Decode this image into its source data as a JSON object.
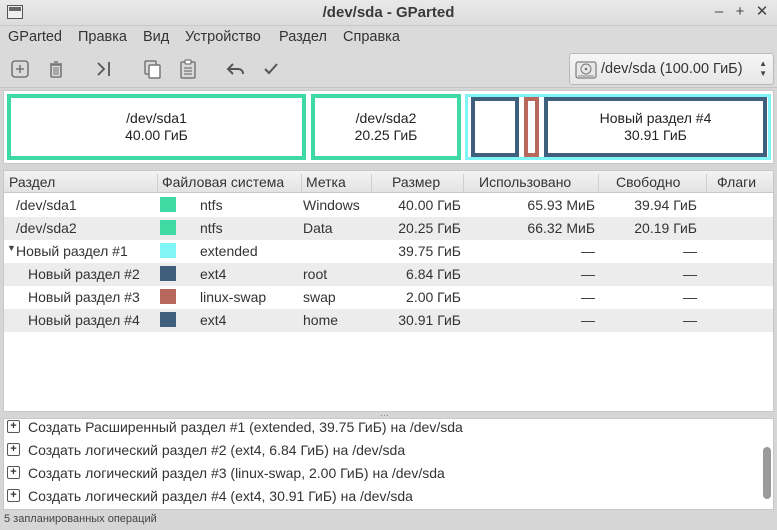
{
  "window": {
    "title": "/dev/sda - GParted"
  },
  "menu": [
    "GParted",
    "Правка",
    "Вид",
    "Устройство",
    "Раздел",
    "Справка"
  ],
  "device_selector": {
    "label": "/dev/sda  (100.00 ГиБ)"
  },
  "map": {
    "sda1": {
      "name": "/dev/sda1",
      "size": "40.00 ГиБ",
      "color": "#3fd9a4"
    },
    "sda2": {
      "name": "/dev/sda2",
      "size": "20.25 ГиБ",
      "color": "#3fd9a4"
    },
    "extended_color": "#7ff5f5",
    "part2_color": "#3f5f7c",
    "part3_color": "#b8675c",
    "part4": {
      "name": "Новый раздел #4",
      "size": "30.91 ГиБ",
      "color": "#3f5f7c"
    }
  },
  "table": {
    "headers": [
      "Раздел",
      "Файловая система",
      "Метка",
      "Размер",
      "Использовано",
      "Свободно",
      "Флаги"
    ],
    "rows": [
      {
        "name": "/dev/sda1",
        "fs": "ntfs",
        "color": "#3fd9a4",
        "label": "Windows",
        "size": "40.00 ГиБ",
        "used": "65.93 МиБ",
        "free": "39.94 ГиБ"
      },
      {
        "name": "/dev/sda2",
        "fs": "ntfs",
        "color": "#3fd9a4",
        "label": "Data",
        "size": "20.25 ГиБ",
        "used": "66.32 МиБ",
        "free": "20.19 ГиБ"
      },
      {
        "name": "Новый раздел #1",
        "fs": "extended",
        "color": "#7ff5f5",
        "label": "",
        "size": "39.75 ГиБ",
        "used": "—",
        "free": "—"
      },
      {
        "name": "Новый раздел #2",
        "fs": "ext4",
        "color": "#3f5f7c",
        "label": "root",
        "size": "6.84 ГиБ",
        "used": "—",
        "free": "—"
      },
      {
        "name": "Новый раздел #3",
        "fs": "linux-swap",
        "color": "#b8675c",
        "label": "swap",
        "size": "2.00 ГиБ",
        "used": "—",
        "free": "—"
      },
      {
        "name": "Новый раздел #4",
        "fs": "ext4",
        "color": "#3f5f7c",
        "label": "home",
        "size": "30.91 ГиБ",
        "used": "—",
        "free": "—"
      }
    ]
  },
  "operations": [
    "Создать Расширенный раздел #1 (extended, 39.75 ГиБ) на /dev/sda",
    "Создать логический раздел #2 (ext4, 6.84 ГиБ) на /dev/sda",
    "Создать логический раздел #3 (linux-swap, 2.00 ГиБ) на /dev/sda",
    "Создать логический раздел #4 (ext4, 30.91 ГиБ) на /dev/sda"
  ],
  "status": "5 запланированных операций"
}
